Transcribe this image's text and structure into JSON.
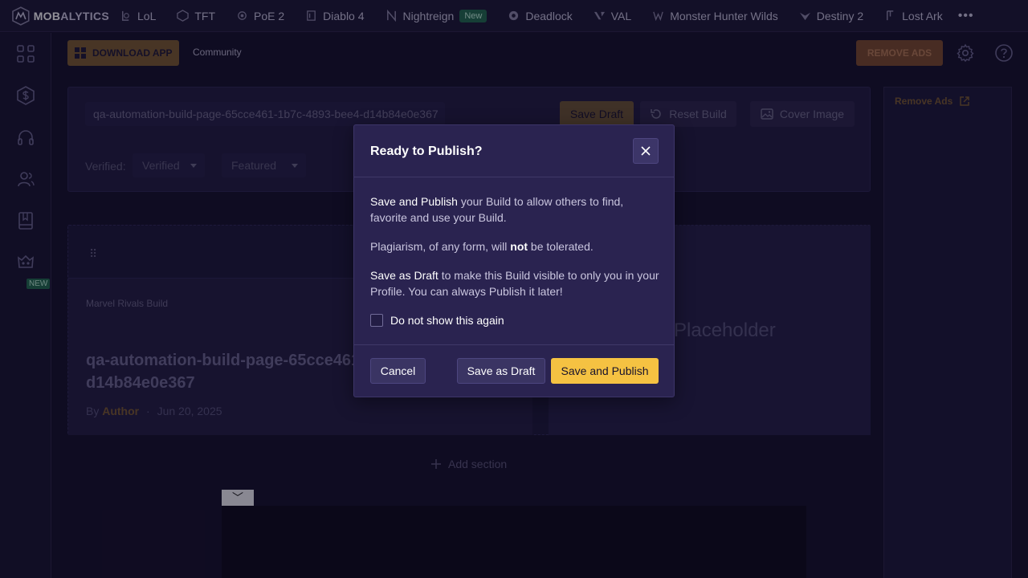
{
  "brand": {
    "logo_prefix": "MOB",
    "logo_suffix": "ALYTICS"
  },
  "topnav": {
    "games": [
      {
        "label": "LoL",
        "icon": "lol-icon"
      },
      {
        "label": "TFT",
        "icon": "tft-icon"
      },
      {
        "label": "PoE 2",
        "icon": "poe2-icon"
      },
      {
        "label": "Diablo 4",
        "icon": "diablo4-icon"
      },
      {
        "label": "Nightreign",
        "icon": "nightreign-icon",
        "badge": "New"
      },
      {
        "label": "Deadlock",
        "icon": "deadlock-icon"
      },
      {
        "label": "VAL",
        "icon": "valorant-icon"
      },
      {
        "label": "Monster Hunter Wilds",
        "icon": "monster-hunter-icon"
      },
      {
        "label": "Destiny 2",
        "icon": "destiny2-icon"
      },
      {
        "label": "Lost Ark",
        "icon": "lost-ark-icon"
      }
    ],
    "more": "•••"
  },
  "sidebar": {
    "new_badge": "NEW"
  },
  "subheader": {
    "download_app": "DOWNLOAD APP",
    "community": "Community",
    "remove_ads": "REMOVE ADS"
  },
  "editor": {
    "slug": "qa-automation-build-page-65cce461-1b7c-4893-bee4-d14b84e0e367",
    "save_draft": "Save Draft",
    "reset_build": "Reset Build",
    "cover_image": "Cover Image",
    "verified_label": "Verified:",
    "verified_value": "Verified",
    "featured_value": "Featured"
  },
  "build_card": {
    "kicker": "Marvel Rivals Build",
    "title": "qa-automation-build-page-65cce461-1b7c-4893-bee4-d14b84e0e367",
    "by": "By",
    "author": "Author",
    "separator": "·",
    "date": "Jun 20, 2025",
    "placeholder": "Placeholder"
  },
  "add_section": "Add section",
  "right_panel": {
    "remove_ads": "Remove Ads"
  },
  "collapse_glyph": "﹀",
  "modal": {
    "title": "Ready to Publish?",
    "p1_bold": "Save and Publish",
    "p1_rest": " your Build to allow others to find, favorite and use your Build.",
    "p2_pre": "Plagiarism, of any form, will ",
    "p2_bold": "not",
    "p2_post": " be tolerated.",
    "p3_bold": "Save as Draft",
    "p3_rest": " to make this Build visible to only you in your Profile. You can always Publish it later!",
    "checkbox_label": "Do not show this again",
    "cancel": "Cancel",
    "save_as_draft": "Save as Draft",
    "save_and_publish": "Save and Publish"
  },
  "colors": {
    "background": "#130f29",
    "accent_gold": "#f5c242",
    "modal_bg": "#2a2350",
    "new_badge": "#1f6b4d"
  }
}
